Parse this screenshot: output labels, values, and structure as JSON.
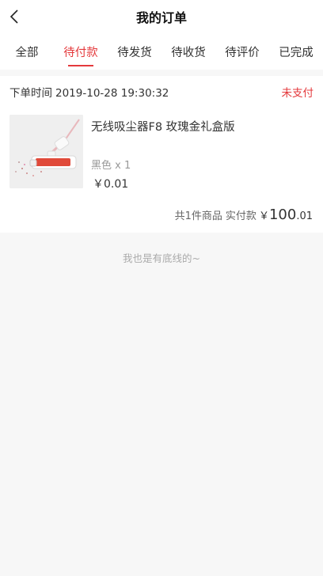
{
  "header": {
    "title": "我的订单",
    "back_icon": "chevron-left-icon"
  },
  "tabs": [
    {
      "label": "全部"
    },
    {
      "label": "待付款",
      "active": true
    },
    {
      "label": "待发货"
    },
    {
      "label": "待收货"
    },
    {
      "label": "待评价"
    },
    {
      "label": "已完成"
    }
  ],
  "order": {
    "time_label": "下单时间",
    "time": "2019-10-28 19:30:32",
    "status": "未支付",
    "product": {
      "name": "无线吸尘器F8 玫瑰金礼盒版",
      "spec": "黑色 x 1",
      "price": "￥0.01",
      "image_icon": "vacuum-cleaner-image"
    },
    "summary": {
      "count_text": "共1件商品",
      "total_label": "实付款",
      "currency": "￥",
      "amount_int": "100",
      "amount_dec": ".01"
    }
  },
  "footer_note": "我也是有底线的~",
  "colors": {
    "accent": "#e4393c",
    "background": "#f7f7f7"
  }
}
